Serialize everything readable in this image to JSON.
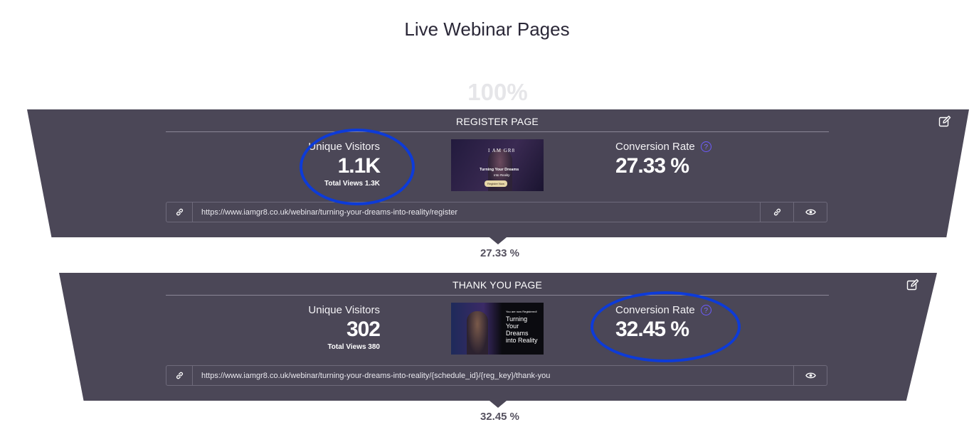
{
  "page": {
    "title": "Live Webinar Pages",
    "top_percent": "100%"
  },
  "steps": [
    {
      "header": "REGISTER PAGE",
      "unique_visitors_label": "Unique Visitors",
      "unique_visitors_value": "1.1K",
      "total_views": "Total Views 1.3K",
      "conversion_label": "Conversion Rate",
      "conversion_value": "27.33 %",
      "url": "https://www.iamgr8.co.uk/webinar/turning-your-dreams-into-reality/register",
      "thumbnail": {
        "logo": "I AM GR8",
        "line1": "Turning Your Dreams",
        "line2": "Into Reality",
        "button": "Register Now"
      },
      "conversion_to_next": "27.33 %"
    },
    {
      "header": "THANK YOU PAGE",
      "unique_visitors_label": "Unique Visitors",
      "unique_visitors_value": "302",
      "total_views": "Total Views 380",
      "conversion_label": "Conversion Rate",
      "conversion_value": "32.45 %",
      "url": "https://www.iamgr8.co.uk/webinar/turning-your-dreams-into-reality/{schedule_id}/{reg_key}/thank-you",
      "thumbnail": {
        "line0": "You are now Registered!",
        "line1": "Turning",
        "line2": "Your",
        "line3": "Dreams",
        "line4": "into Reality"
      },
      "conversion_to_next": "32.45 %"
    }
  ],
  "icons": {
    "edit": "edit-icon",
    "link": "link-icon",
    "copy_link": "copy-link-icon",
    "preview": "eye-icon",
    "help": "help-icon"
  },
  "colors": {
    "funnel_bg": "#4b4757",
    "highlight_ring": "#0d3bd8",
    "help_accent": "#6d5cff"
  }
}
